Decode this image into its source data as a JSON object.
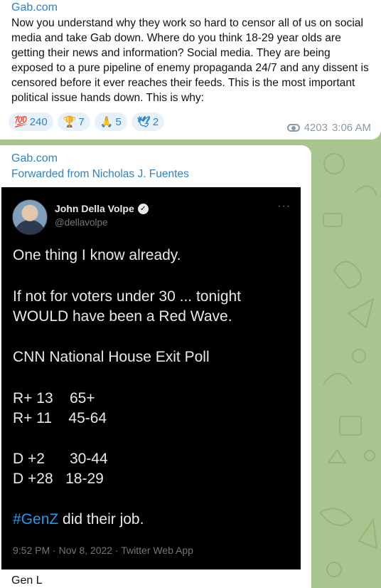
{
  "message1": {
    "sender": "Gab.com",
    "body": "Now you understand why they work so hard to censor all of us on social media and take Gab down. Where do you think 18-29 year olds are getting their news and information? Social media. They are being exposed to a pure pipeline of enemy propaganda 24/7 and any dissent is censored before it ever reaches their feeds. This is the most important political issue hands down. This is why:",
    "reactions": [
      {
        "emoji": "💯",
        "count": "240"
      },
      {
        "emoji": "🏆",
        "count": "7"
      },
      {
        "emoji": "🙏",
        "count": "5"
      },
      {
        "emoji": "🕊",
        "count": "2"
      }
    ],
    "views": "4203",
    "time": "3:06 AM"
  },
  "message2": {
    "sender": "Gab.com",
    "forwarded": "Forwarded from Nicholas J. Fuentes",
    "caption": "Gen L",
    "tweet": {
      "name": "John Della Volpe",
      "handle": "@dellavolpe",
      "lines": [
        "One thing I know already.",
        "If not for voters under 30 ... tonight",
        "WOULD have been a Red Wave.",
        "CNN National House Exit Poll",
        "R+ 13    65+",
        "R+ 11    45-64",
        "D +2      30-44",
        "D +28   18-29"
      ],
      "hashtag": "#GenZ",
      "closing": " did their job.",
      "meta": "9:52 PM · Nov 8, 2022 · Twitter Web App"
    }
  }
}
